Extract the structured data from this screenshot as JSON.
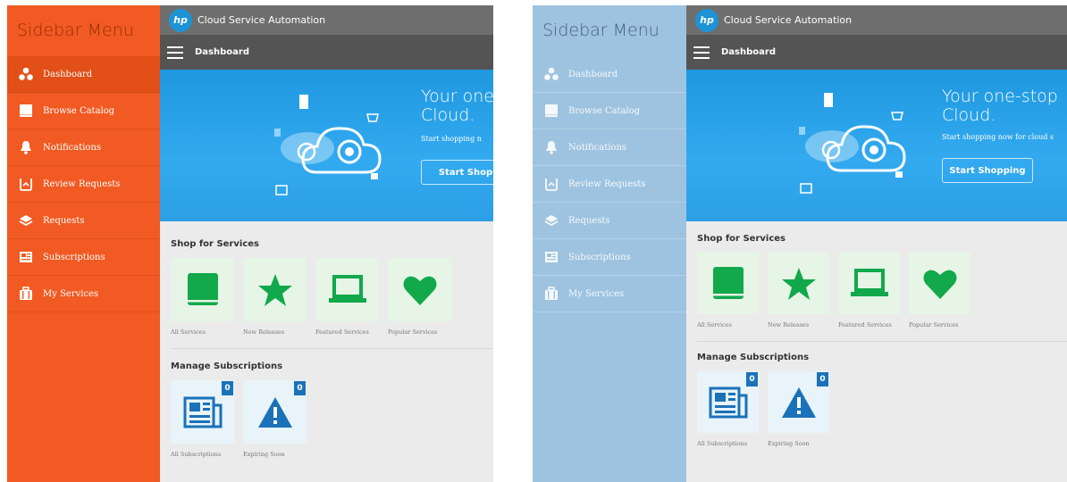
{
  "colors": {
    "left_sidebar": "#f15a22",
    "right_sidebar": "#9ec3e0",
    "topbar": "#6e6e6e",
    "subbar": "#545454",
    "hero_blue": "#2c9fe6",
    "shop_green": "#12a84c",
    "manage_blue": "#1a72b8"
  },
  "left": {
    "sidebar": {
      "title": "Sidebar Menu",
      "items": [
        {
          "label": "Dashboard",
          "icon": "dots-icon",
          "active": true
        },
        {
          "label": "Browse Catalog",
          "icon": "book-icon"
        },
        {
          "label": "Notifications",
          "icon": "bell-icon"
        },
        {
          "label": "Review Requests",
          "icon": "review-icon"
        },
        {
          "label": "Requests",
          "icon": "layers-icon"
        },
        {
          "label": "Subscriptions",
          "icon": "newspaper-icon"
        },
        {
          "label": "My Services",
          "icon": "briefcase-icon"
        }
      ]
    },
    "header": {
      "logo": "hp",
      "app_title": "Cloud Service Automation",
      "page_title": "Dashboard"
    },
    "hero": {
      "title_line1": "Your one",
      "title_line2": "Cloud.",
      "subtitle": "Start shopping n",
      "button": "Start Shop"
    },
    "shop": {
      "title": "Shop for Services",
      "tiles": [
        {
          "label": "All Services",
          "icon": "book-icon"
        },
        {
          "label": "New Releases",
          "icon": "star-icon"
        },
        {
          "label": "Featured Services",
          "icon": "laptop-icon"
        },
        {
          "label": "Popular Services",
          "icon": "heart-icon"
        }
      ]
    },
    "manage": {
      "title": "Manage Subscriptions",
      "tiles": [
        {
          "label": "All Subscriptions",
          "icon": "newspaper-icon",
          "count": "0"
        },
        {
          "label": "Expiring Soon",
          "icon": "warning-icon",
          "count": "0"
        }
      ]
    }
  },
  "right": {
    "sidebar": {
      "title": "Sidebar Menu",
      "items": [
        {
          "label": "Dashboard",
          "icon": "dots-icon"
        },
        {
          "label": "Browse Catalog",
          "icon": "book-icon"
        },
        {
          "label": "Notifications",
          "icon": "bell-icon"
        },
        {
          "label": "Review Requests",
          "icon": "review-icon"
        },
        {
          "label": "Requests",
          "icon": "layers-icon"
        },
        {
          "label": "Subscriptions",
          "icon": "newspaper-icon"
        },
        {
          "label": "My Services",
          "icon": "briefcase-icon"
        }
      ]
    },
    "header": {
      "logo": "hp",
      "app_title": "Cloud Service Automation",
      "page_title": "Dashboard"
    },
    "hero": {
      "title_line1": "Your one-stop",
      "title_line2": "Cloud.",
      "subtitle": "Start shopping now for cloud s",
      "button": "Start Shopping"
    },
    "shop": {
      "title": "Shop for Services",
      "tiles": [
        {
          "label": "All Services",
          "icon": "book-icon"
        },
        {
          "label": "New Releases",
          "icon": "star-icon"
        },
        {
          "label": "Featured Services",
          "icon": "laptop-icon"
        },
        {
          "label": "Popular Services",
          "icon": "heart-icon"
        }
      ]
    },
    "manage": {
      "title": "Manage Subscriptions",
      "tiles": [
        {
          "label": "All Subscriptions",
          "icon": "newspaper-icon",
          "count": "0"
        },
        {
          "label": "Expiring Soon",
          "icon": "warning-icon",
          "count": "0"
        }
      ]
    }
  }
}
